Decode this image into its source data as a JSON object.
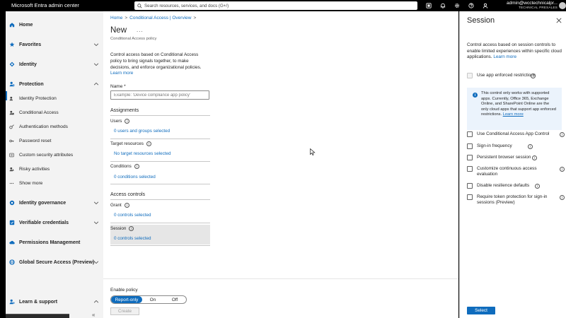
{
  "topbar": {
    "app_title": "Microsoft Entra admin center",
    "search_placeholder": "Search resources, services, and docs (G+/)",
    "icons": [
      "copilot-icon",
      "bell-icon",
      "gear-icon",
      "help-icon",
      "feedback-icon"
    ],
    "account_name": "admin@wcctechnicalpr...",
    "account_org": "TECHNICAL PRESALES"
  },
  "sidebar": {
    "items": [
      {
        "label": "Home",
        "icon": "home-icon",
        "expandable": false
      },
      {
        "label": "Favorites",
        "icon": "star-icon",
        "expandable": true
      },
      {
        "label": "Identity",
        "icon": "diamond-icon",
        "expandable": true
      },
      {
        "label": "Protection",
        "icon": "person-shield-icon",
        "expandable": true,
        "expanded": true
      },
      {
        "label": "Identity governance",
        "icon": "governance-icon",
        "expandable": true
      },
      {
        "label": "Verifiable credentials",
        "icon": "credential-icon",
        "expandable": true
      },
      {
        "label": "Permissions Management",
        "icon": "cloud-key-icon",
        "expandable": false
      },
      {
        "label": "Global Secure Access (Preview)",
        "icon": "globe-icon",
        "expandable": true
      },
      {
        "label": "Learn & support",
        "icon": "person-help-icon",
        "expandable": true,
        "expanded": true
      }
    ],
    "protection_sub": [
      {
        "label": "Identity Protection",
        "icon": "id-protection-icon"
      },
      {
        "label": "Conditional Access",
        "icon": "conditional-access-icon",
        "active": true
      },
      {
        "label": "Authentication methods",
        "icon": "auth-methods-icon"
      },
      {
        "label": "Password reset",
        "icon": "key-icon"
      },
      {
        "label": "Custom security attributes",
        "icon": "attributes-icon"
      },
      {
        "label": "Risky activities",
        "icon": "risk-icon"
      },
      {
        "label": "Show more",
        "icon": "more-icon"
      }
    ],
    "collapse_glyph": "«"
  },
  "main": {
    "breadcrumb": [
      "Home",
      "Conditional Access | Overview"
    ],
    "breadcrumb_sep": ">",
    "title": "New",
    "more": "...",
    "subtitle": "Conditional Access policy",
    "description": "Control access based on Conditional Access policy to bring signals together, to make decisions, and enforce organizational policies.",
    "learn_more": "Learn more",
    "name_label": "Name *",
    "name_placeholder": "Example: 'Device compliance app policy'",
    "name_value": "",
    "assignments_heading": "Assignments",
    "users_label": "Users",
    "users_link": "0 users and groups selected",
    "target_label": "Target resources",
    "target_link": "No target resources selected",
    "conditions_label": "Conditions",
    "conditions_link": "0 conditions selected",
    "access_heading": "Access controls",
    "grant_label": "Grant",
    "grant_link": "0 controls selected",
    "session_label": "Session",
    "session_link": "0 controls selected",
    "info_glyph": "i",
    "enable_label": "Enable policy",
    "toggle": [
      {
        "label": "Report-only",
        "selected": true
      },
      {
        "label": "On",
        "selected": false
      },
      {
        "label": "Off",
        "selected": false
      }
    ],
    "create_label": "Create"
  },
  "panel": {
    "title": "Session",
    "description": "Control access based on session controls to enable limited experiences within specific cloud applications.",
    "learn_more": "Learn more",
    "app_enforced_label": "Use app enforced restrictions",
    "info_text": "This control only works with supported apps. Currently, Office 365, Exchange Online, and SharePoint Online are the only cloud apps that support app enforced restrictions.",
    "info_link": "Learn more",
    "options": [
      {
        "label": "Use Conditional Access App Control",
        "checked": false
      },
      {
        "label": "Sign-in frequency",
        "checked": false
      },
      {
        "label": "Persistent browser session",
        "checked": false
      },
      {
        "label": "Customize continuous access evaluation",
        "checked": false
      },
      {
        "label": "Disable resilience defaults",
        "checked": false
      },
      {
        "label": "Require token protection for sign-in sessions (Preview)",
        "checked": false
      }
    ],
    "select_label": "Select"
  },
  "colors": {
    "accent": "#0f6cbd",
    "sidebar_bg": "#f3f3f3",
    "topbar_bg": "#000000",
    "info_bg": "#ebf3fc"
  }
}
